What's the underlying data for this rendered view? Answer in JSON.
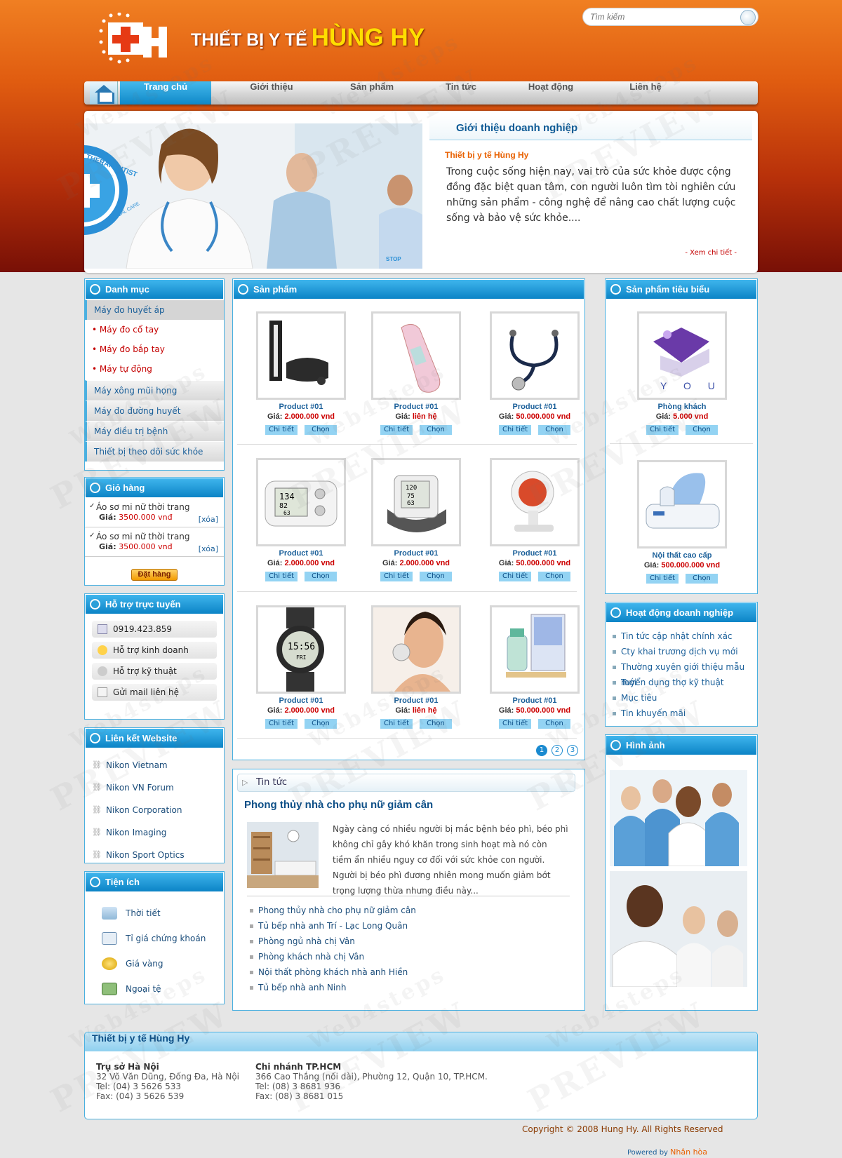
{
  "header": {
    "title_prefix": "THIẾT BỊ Y TẾ",
    "title_brand": "HÙNG HY",
    "search_placeholder": "Tìm kiếm"
  },
  "nav": {
    "items": [
      "Trang chủ",
      "Giới thiệu",
      "Sản phẩm",
      "Tin tức",
      "Hoạt động",
      "Liên hệ"
    ],
    "active": "Trang chủ"
  },
  "banner": {
    "image_text_1": "THERAPEUTIST",
    "image_text_2": "STOP MEDICAL CARE",
    "image_text_3": "STOP"
  },
  "intro": {
    "heading": "Giới thiệu doanh nghiệp",
    "title": "Thiết bị y tế Hùng Hy",
    "text": "Trong cuộc sống hiện nay, vai trò của sức khỏe được cộng đồng đặc biệt quan tâm, con người luôn tìm tòi nghiên cứu những sản phẩm - công nghệ để nâng cao chất lượng cuộc sống và bảo vệ sức khỏe....",
    "more": "- Xem chi tiết -"
  },
  "categories": {
    "heading": "Danh mục",
    "items": [
      {
        "label": "Máy đo huyết áp"
      },
      {
        "label": "Máy đo cổ tay"
      },
      {
        "label": "Máy đo bắp tay"
      },
      {
        "label": "Máy tự động"
      },
      {
        "label": "Máy xông mũi họng"
      },
      {
        "label": "Máy đo đường huyết"
      },
      {
        "label": "Máy điều trị bệnh"
      },
      {
        "label": "Thiết bị theo dõi sức khỏe"
      }
    ]
  },
  "cart": {
    "heading": "Giỏ hàng",
    "items": [
      {
        "name": "Áo sơ mi nữ thời trang",
        "price_label": "Giá:",
        "price": "3500.000 vnđ",
        "remove": "[xóa]"
      },
      {
        "name": "Áo sơ mi nữ thời trang",
        "price_label": "Giá:",
        "price": "3500.000 vnđ",
        "remove": "[xóa]"
      }
    ],
    "order_button": "Đặt hàng"
  },
  "support": {
    "heading": "Hỗ trợ trực tuyến",
    "items": [
      "0919.423.859",
      "Hỗ trợ kinh doanh",
      "Hỗ trợ kỹ thuật",
      "Gửi mail liên hệ"
    ]
  },
  "links": {
    "heading": "Liên kết Website",
    "items": [
      "Nikon Vietnam",
      "Nikon VN Forum",
      "Nikon Corporation",
      "Nikon Imaging",
      "Nikon Sport Optics"
    ]
  },
  "tools": {
    "heading": "Tiện ích",
    "items": [
      "Thời tiết",
      "Tỉ giá chứng khoán",
      "Giá vàng",
      "Ngoại tệ"
    ]
  },
  "products": {
    "heading": "Sản phẩm",
    "price_label": "Giá:",
    "detail_button": "Chi tiết",
    "choose_button": "Chọn",
    "items": [
      {
        "name": "Product #01",
        "price": "2.000.000 vnd",
        "icon": "sphygmomanometer"
      },
      {
        "name": "Product #01",
        "price": "liên hệ",
        "icon": "thermometer"
      },
      {
        "name": "Product #01",
        "price": "50.000.000 vnd",
        "icon": "stethoscope"
      },
      {
        "name": "Product #01",
        "price": "2.000.000 vnd",
        "icon": "blood-pressure-monitor"
      },
      {
        "name": "Product #01",
        "price": "2.000.000 vnd",
        "icon": "wrist-monitor"
      },
      {
        "name": "Product #01",
        "price": "50.000.000 vnd",
        "icon": "infrared-lamp"
      },
      {
        "name": "Product #01",
        "price": "2.000.000 vnd",
        "icon": "heart-rate-watch"
      },
      {
        "name": "Product #01",
        "price": "liên hệ",
        "icon": "facial-device"
      },
      {
        "name": "Product #01",
        "price": "50.000.000 vnd",
        "icon": "wax-heater"
      }
    ],
    "pages": [
      "1",
      "2",
      "3"
    ],
    "current_page": "1",
    "monitor_readings": [
      "134",
      "82",
      "63"
    ],
    "wrist_readings": [
      "120",
      "75",
      "63"
    ],
    "watch_reading": "15:56",
    "watch_day": "FRI"
  },
  "news": {
    "heading": "Tin tức",
    "title": "Phong thủy nhà cho phụ nữ giảm cân",
    "text": "Ngày càng có nhiều người bị mắc bệnh béo phì, béo phì không chỉ gây khó khăn trong sinh hoạt mà nó còn tiềm ẩn nhiều nguy cơ đối với sức khỏe con người. Người bị béo phì đương nhiên mong muốn giảm bớt trọng lượng thừa nhưng điều này...",
    "list": [
      "Phong thủy nhà cho phụ nữ giảm cân",
      "Tủ bếp nhà anh Trí - Lạc Long Quân",
      "Phòng ngủ nhà chị Vân",
      "Phòng khách nhà chị Vân",
      "Nội thất phòng khách nhà anh Hiền",
      "Tủ bếp nhà anh Ninh"
    ]
  },
  "featured": {
    "heading": "Sản phẩm tiêu biểu",
    "items": [
      {
        "name": "Phòng khách",
        "price": "5.000 vnd",
        "image_text": "Y O U"
      },
      {
        "name": "Nội thất cao cấp",
        "price": "500.000.000 vnd"
      }
    ]
  },
  "activities": {
    "heading": "Hoạt động doanh nghiệp",
    "items": [
      "Tin tức cập nhật chính xác",
      "Cty khai trương dịch vụ mới",
      "Thường xuyên giới thiệu mẫu mới",
      "Tuyển dụng thợ kỹ thuật",
      "Mục tiêu",
      "Tin khuyến mãi"
    ]
  },
  "gallery": {
    "heading": "Hình ảnh"
  },
  "footer": {
    "heading": "Thiết bị y tế Hùng Hy",
    "hanoi": {
      "title": "Trụ sở Hà Nội",
      "address": "32 Võ Văn Dũng, Đống Đa, Hà Nội",
      "tel": "Tel: (04) 3 5626 533",
      "fax": "Fax: (04) 3 5626 539"
    },
    "hcm": {
      "title": "Chi nhánh TP.HCM",
      "address": "366 Cao Thắng (nối dài), Phường 12, Quận 10, TP.HCM.",
      "tel": "Tel: (08) 3 8681 936",
      "fax": "Fax: (08) 3 8681 015"
    },
    "copyright": "Copyright © 2008 Hung Hy. All Rights Reserved",
    "powered_label": "Powered by",
    "powered_brand": "Nhân hòa"
  },
  "watermark": {
    "brand": "Web4steps",
    "label": "PREVIEW"
  },
  "colors": {
    "accent": "#0c84c6",
    "header_orange": "#f07f22",
    "price_red": "#cc0000",
    "brand_yellow": "#ffde00"
  }
}
